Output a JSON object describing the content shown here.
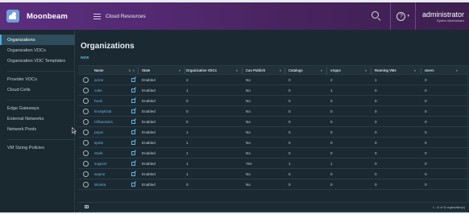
{
  "header": {
    "app_name": "Moonbeam",
    "section": "Cloud Resources",
    "help_label": "?",
    "user_name": "administrator",
    "user_role": "System Administrator"
  },
  "sidebar": {
    "items": [
      {
        "label": "Organizations",
        "active": true
      },
      {
        "label": "Organization VDCs"
      },
      {
        "label": "Organization VDC Templates"
      },
      {
        "label": "Provider VDCs"
      },
      {
        "label": "Cloud Cells"
      },
      {
        "label": "Edge Gateways"
      },
      {
        "label": "External Networks"
      },
      {
        "label": "Network Pools"
      },
      {
        "label": "VM Sizing Policies"
      }
    ]
  },
  "main": {
    "title": "Organizations",
    "new_label": "NEW"
  },
  "table": {
    "columns": [
      "Name",
      "State",
      "Organization VDCs",
      "Can Publish",
      "Catalogs",
      "vApps",
      "Running VMs",
      "Users"
    ],
    "rows": [
      {
        "name": "acme",
        "state": "Enabled",
        "vdcs": "2",
        "publish": "No",
        "catalogs": "0",
        "vapps": "2",
        "vms": "1",
        "users": "0"
      },
      {
        "name": "coke",
        "state": "Enabled",
        "vdcs": "1",
        "publish": "No",
        "catalogs": "0",
        "vapps": "1",
        "vms": "0",
        "users": "0"
      },
      {
        "name": "hooli",
        "state": "Enabled",
        "vdcs": "0",
        "publish": "No",
        "catalogs": "0",
        "vapps": "0",
        "vms": "0",
        "users": "0"
      },
      {
        "name": "krustykrab",
        "state": "Enabled",
        "vdcs": "0",
        "publish": "No",
        "catalogs": "0",
        "vapps": "0",
        "vms": "0",
        "users": "0"
      },
      {
        "name": "Ollivanders",
        "state": "Enabled",
        "vdcs": "0",
        "publish": "No",
        "catalogs": "0",
        "vapps": "0",
        "vms": "0",
        "users": "0"
      },
      {
        "name": "pepsi",
        "state": "Enabled",
        "vdcs": "1",
        "publish": "No",
        "catalogs": "0",
        "vapps": "0",
        "vms": "0",
        "users": "0"
      },
      {
        "name": "sprite",
        "state": "Enabled",
        "vdcs": "1",
        "publish": "No",
        "catalogs": "0",
        "vapps": "0",
        "vms": "0",
        "users": "0"
      },
      {
        "name": "Stark",
        "state": "Enabled",
        "vdcs": "1",
        "publish": "No",
        "catalogs": "0",
        "vapps": "0",
        "vms": "0",
        "users": "0"
      },
      {
        "name": "support",
        "state": "Enabled",
        "vdcs": "1",
        "publish": "Yes",
        "catalogs": "1",
        "vapps": "1",
        "vms": "0",
        "users": "0"
      },
      {
        "name": "wayne",
        "state": "Enabled",
        "vdcs": "1",
        "publish": "No",
        "catalogs": "0",
        "vapps": "0",
        "vms": "0",
        "users": "0"
      },
      {
        "name": "Wonka",
        "state": "Enabled",
        "vdcs": "0",
        "publish": "No",
        "catalogs": "0",
        "vapps": "0",
        "vms": "0",
        "users": "0"
      }
    ],
    "footer": "1 - 11 of 11 organization(s)"
  },
  "colors": {
    "header_gradient_start": "#5b2e7e",
    "background": "#1b2a32",
    "active_nav": "#2e4c5c",
    "link": "#62b3e4"
  },
  "icons": [
    "logo-icon",
    "hamburger-icon",
    "search-icon",
    "help-icon",
    "external-link-icon",
    "filter-icon",
    "column-toggle-icon",
    "mouse-pointer-icon"
  ]
}
